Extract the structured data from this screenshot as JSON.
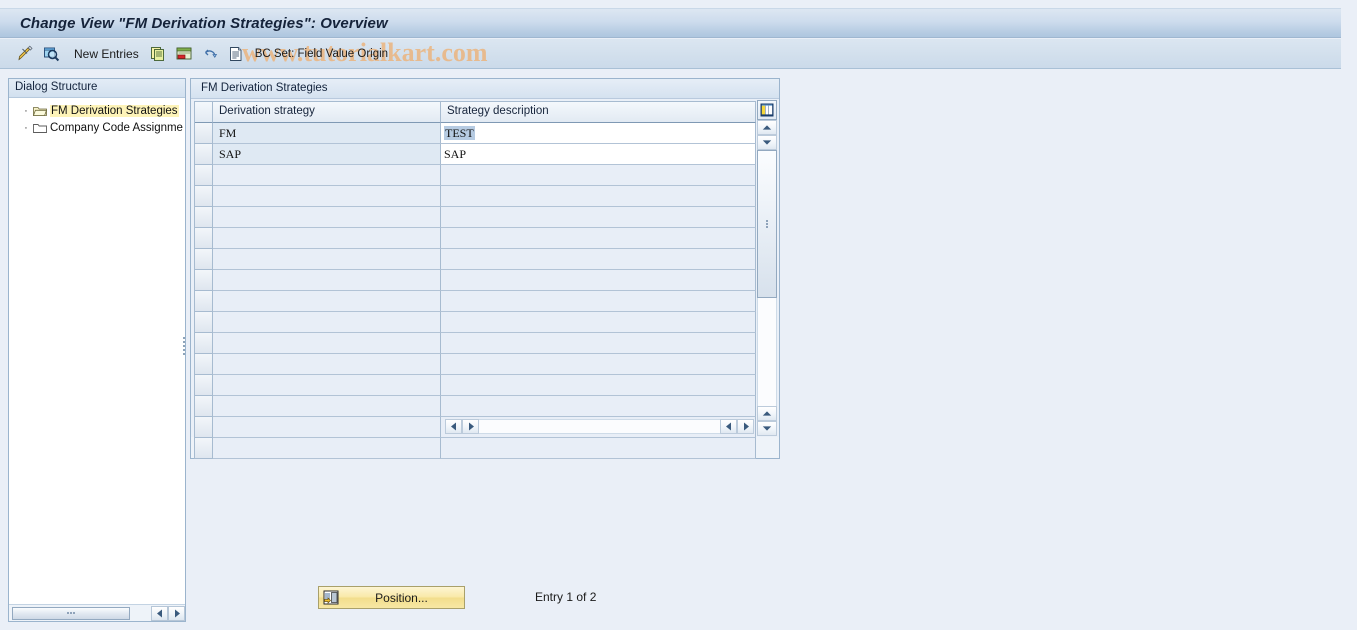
{
  "window": {
    "title": "Change View \"FM Derivation Strategies\": Overview"
  },
  "toolbar": {
    "items": [
      {
        "name": "display-change-icon",
        "label": "",
        "icon": "pencil-ruler-icon"
      },
      {
        "name": "display-details-icon",
        "label": "",
        "icon": "magnifier-icon"
      },
      {
        "name": "new-entries-button",
        "label": "New Entries",
        "icon": ""
      },
      {
        "name": "copy-as-icon",
        "label": "",
        "icon": "copy-icon"
      },
      {
        "name": "delete-icon",
        "label": "",
        "icon": "delete-row-icon"
      },
      {
        "name": "undo-icon",
        "label": "",
        "icon": "undo-arrow-icon"
      },
      {
        "name": "select-all-icon",
        "label": "",
        "icon": "document-lines-icon"
      },
      {
        "name": "bc-set-button",
        "label": "BC Set: Field Value Origin",
        "icon": ""
      }
    ],
    "watermark": "www.tutorialkart.com"
  },
  "sidebar": {
    "header": "Dialog Structure",
    "items": [
      {
        "label": "FM Derivation Strategies",
        "selected": true,
        "icon": "folder-open-icon"
      },
      {
        "label": "Company Code Assignme",
        "selected": false,
        "icon": "folder-closed-icon"
      }
    ]
  },
  "panel": {
    "title": "FM Derivation Strategies",
    "columns": [
      {
        "label": "Derivation strategy"
      },
      {
        "label": "Strategy description"
      }
    ],
    "rows": [
      {
        "strategy": "FM",
        "description": "TEST",
        "description_selected": true
      },
      {
        "strategy": "SAP",
        "description": "SAP",
        "description_selected": false
      }
    ],
    "empty_row_count": 14,
    "config_icon": "table-settings-icon"
  },
  "footer": {
    "position_button": "Position...",
    "entry_status": "Entry 1 of 2"
  },
  "colors": {
    "title_bar": "#b8cde3",
    "page_background": "#eaeff7",
    "selection_highlight": "#b6cbe2",
    "tree_selected": "#fdf3b8",
    "button_yellow": "#f9e9a8",
    "watermark": "#e9b98a"
  }
}
